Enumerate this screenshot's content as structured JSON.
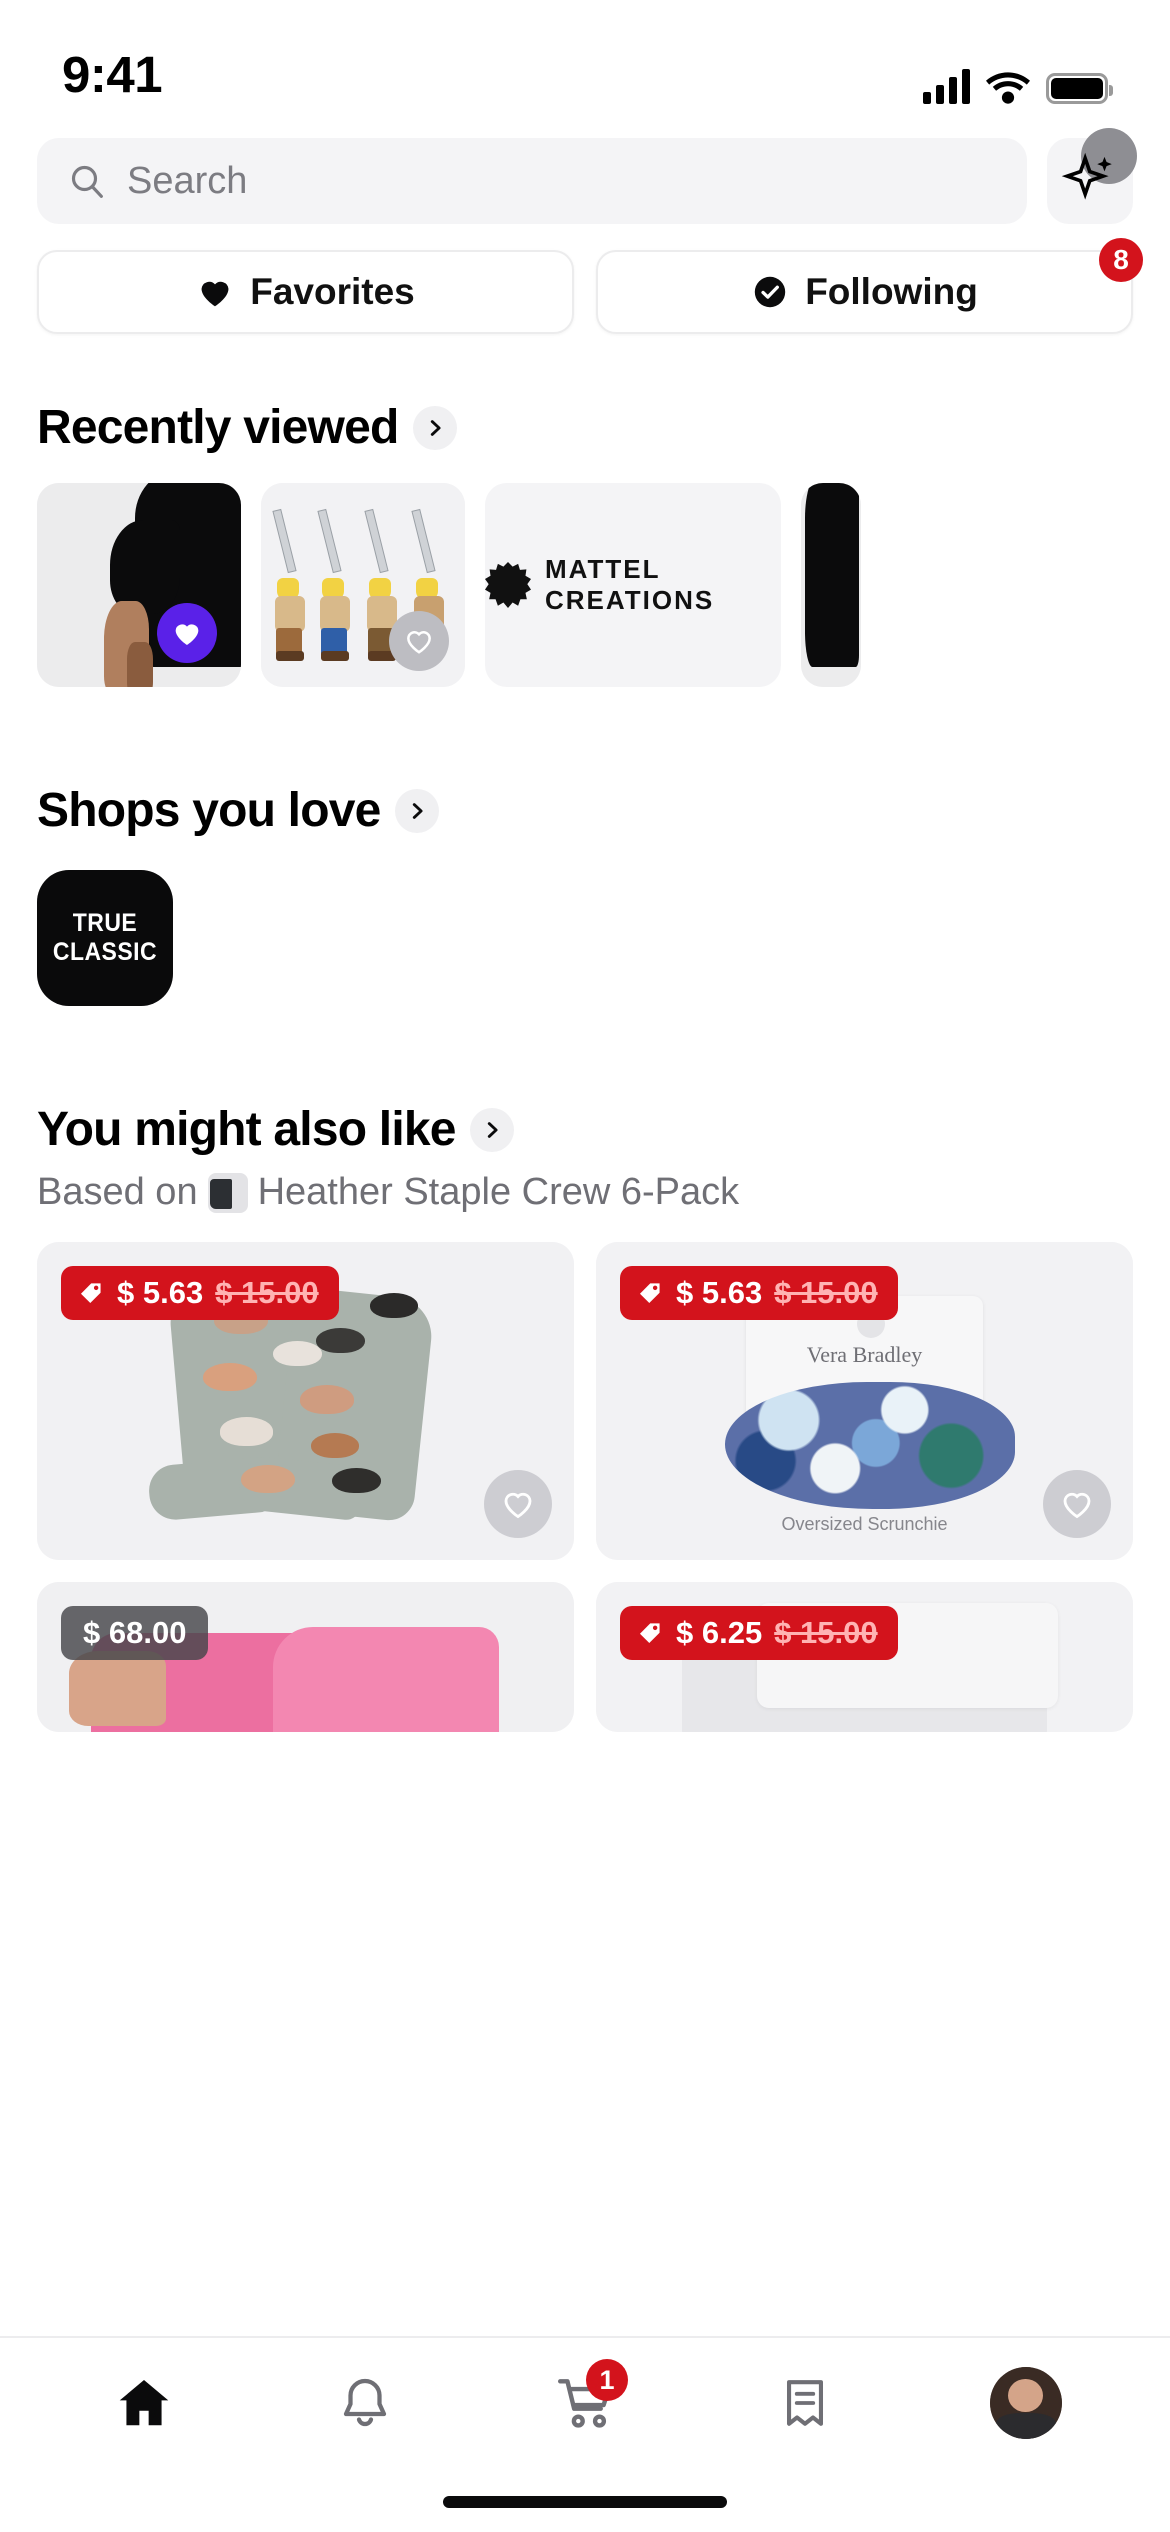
{
  "status_bar": {
    "time": "9:41",
    "signal_icon": "cellular-bars-icon",
    "wifi_icon": "wifi-icon",
    "battery_icon": "battery-full-icon"
  },
  "search": {
    "placeholder": "Search",
    "icon": "search-icon",
    "ai_button_icon": "sparkle-icon"
  },
  "filters": [
    {
      "label": "Favorites",
      "icon": "heart-filled-icon",
      "badge": ""
    },
    {
      "label": "Following",
      "icon": "check-circle-filled-icon",
      "badge": "8"
    }
  ],
  "sections": {
    "recently_viewed": {
      "title": "Recently viewed",
      "chevron_icon": "chevron-right-icon",
      "cards": [
        {
          "name": "black-tshirt-card",
          "favorited": true,
          "heart_icon": "heart-filled-icon",
          "heart_color": "#5A21E8"
        },
        {
          "name": "he-man-figures-card",
          "favorited": false,
          "heart_icon": "heart-outline-icon",
          "heart_color": "#BDBDC2"
        },
        {
          "name": "mattel-creations-card",
          "logo_text": "MATTEL CREATIONS",
          "logo_icon": "starburst-icon"
        },
        {
          "name": "partial-card",
          "favorited": false
        }
      ]
    },
    "shops_you_love": {
      "title": "Shops you love",
      "chevron_icon": "chevron-right-icon",
      "shops": [
        {
          "name": "true-classic",
          "logo_text": "TRUE CLASSIC",
          "bg": "#0A0A0B"
        }
      ]
    },
    "you_might_also_like": {
      "title": "You might also like",
      "chevron_icon": "chevron-right-icon",
      "subtitle_prefix": "Based on",
      "subtitle_product": "Heather Staple Crew 6-Pack",
      "subtitle_thumb_icon": "product-thumbnail-icon",
      "products": [
        {
          "name": "pet-print-socks",
          "price": "$ 5.63",
          "original_price": "$ 15.00",
          "badge_type": "sale",
          "tag_icon": "price-tag-icon",
          "heart_icon": "heart-outline-icon"
        },
        {
          "name": "vera-bradley-scrunchie",
          "price": "$ 5.63",
          "original_price": "$ 15.00",
          "badge_type": "sale",
          "tag_icon": "price-tag-icon",
          "heart_icon": "heart-outline-icon",
          "brand_text": "Vera Bradley",
          "label_text": "Oversized Scrunchie"
        },
        {
          "name": "pink-jacket",
          "price": "$ 68.00",
          "original_price": "",
          "badge_type": "plain"
        },
        {
          "name": "grey-product",
          "price": "$ 6.25",
          "original_price": "$ 15.00",
          "badge_type": "sale",
          "tag_icon": "price-tag-icon"
        }
      ]
    }
  },
  "tabbar": {
    "items": [
      {
        "name": "home",
        "icon": "home-filled-icon",
        "badge": "",
        "active": true
      },
      {
        "name": "notifications",
        "icon": "bell-outline-icon",
        "badge": ""
      },
      {
        "name": "cart",
        "icon": "shopping-cart-icon",
        "badge": "1"
      },
      {
        "name": "orders",
        "icon": "receipt-outline-icon",
        "badge": ""
      },
      {
        "name": "profile",
        "icon": "avatar-icon",
        "badge": ""
      }
    ]
  },
  "colors": {
    "accent_purple": "#5A21E8",
    "badge_red": "#D3131C",
    "card_bg": "#F3F3F5",
    "chip_border": "#ECECED"
  }
}
